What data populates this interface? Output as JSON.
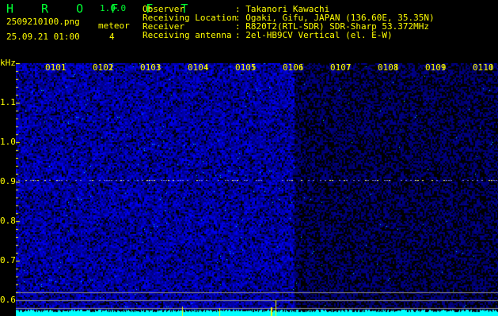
{
  "app": {
    "name": "H R O F F T",
    "version": "1.0.0"
  },
  "file": {
    "filename": "2509210100.png",
    "datetime": "25.09.21 01:00"
  },
  "meteor": {
    "label": "meteor",
    "count": "4"
  },
  "info": [
    {
      "label": "Observer",
      "value": ": Takanori Kawachi"
    },
    {
      "label": "Receiving Location",
      "value": ": Ogaki, Gifu, JAPAN (136.60E, 35.35N)"
    },
    {
      "label": "Receiver",
      "value": ": R820T2(RTL-SDR) SDR-Sharp 53.372MHz"
    },
    {
      "label": "Receiving antenna",
      "value": ": 2el-HB9CV Vertical (el. E-W)"
    }
  ],
  "axis": {
    "y_unit": "kHz",
    "y_ticks": [
      "1.1",
      "1.0",
      "0.9",
      "0.8",
      "0.7",
      "0.6"
    ],
    "x_ticks": [
      "0101",
      "0102",
      "0103",
      "0104",
      "0105",
      "0106",
      "0107",
      "0108",
      "0109",
      "0110"
    ]
  },
  "colors": {
    "text": "#ffff00",
    "brand": "#00ff33",
    "noise": "#0000ff",
    "signal": "#00ffff"
  }
}
